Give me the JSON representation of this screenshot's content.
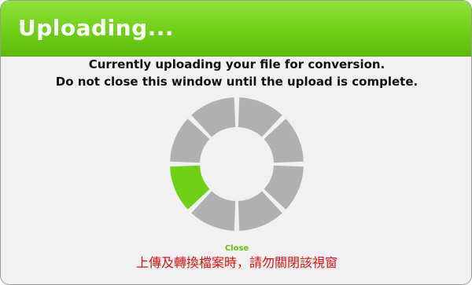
{
  "dialog": {
    "title": "Uploading...",
    "message_line1": "Currently uploading your file for conversion.",
    "message_line2": "Do not close this window until the upload is complete.",
    "close_label": "Close",
    "warning_cn": "上傳及轉換檔案時，請勿關閉該視窗"
  },
  "spinner": {
    "segment_count": 8,
    "active_segment": 5,
    "active_color": "#6fd017",
    "inactive_color": "#b0b0b0"
  },
  "colors": {
    "titlebar_green": "#6fcf16",
    "close_link_green": "#66bb11",
    "warning_red": "#e01010"
  }
}
